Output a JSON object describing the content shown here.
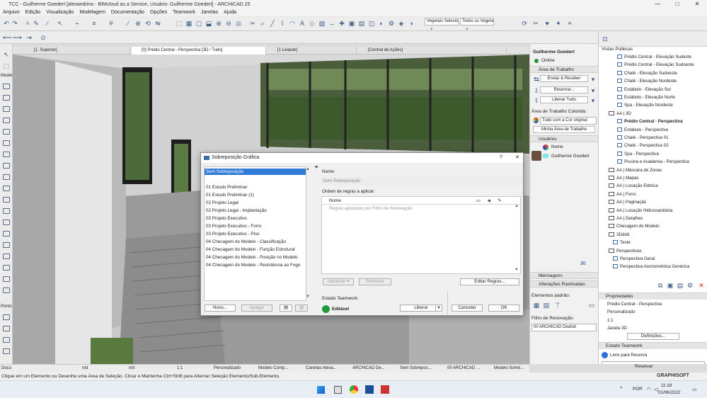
{
  "window": {
    "title": "TCC - Guilherme Goedert [alexandrino - BIMcloud as a Service, Usuário: Guilherme Goedert] - ARCHICAD 25",
    "minimize": "—",
    "maximize": "□",
    "close": "✕"
  },
  "menu": [
    "Arquivo",
    "Edição",
    "Visualização",
    "Modelagem",
    "Documentação",
    "Opções",
    "Teamwork",
    "Janelas",
    "Ajuda"
  ],
  "toolbar": {
    "layer_combo1": "Vegetais Seleciona",
    "layer_combo2": "Todos os Vegetais"
  },
  "tabs": [
    {
      "label": "[1. Superior]"
    },
    {
      "label": "[0] Prédio Central - Perspectiva [3D / Tudo]"
    },
    {
      "label": "[1 Leiaute]"
    },
    {
      "label": "[Central de Ações]"
    }
  ],
  "left_toolbox": {
    "section_model": "Model",
    "section_docu": "Docu",
    "section_ponto": "Ponto"
  },
  "teamwork": {
    "user": "Guilherme Goedert",
    "status": "Online",
    "workspace_header": "Área de Trabalho",
    "send_receive": "Enviar & Receber",
    "reserve": "Reservar...",
    "release_all": "Liberar Tudo",
    "colored_workspace_label": "Área de Trabalho Colorida:",
    "colored_workspace_value": "Tudo com a Cor original",
    "my_workspace": "Minha Área de Trabalho",
    "users_header": "Usuários",
    "name_col": "Nome",
    "user_row": "Guilherme Goedert",
    "messages": "Mensagens",
    "tracked_changes": "Alterações Rastreadas",
    "default_elements": "Elementos padrão:",
    "renovation_filter_label": "Filtro de Renovação:",
    "renovation_filter_value": "00 ARCHICAD Deafult"
  },
  "navigator": {
    "header": "Vistas Públicas",
    "items": [
      {
        "label": "Prédio Central - Elevação Sudeste",
        "type": "view"
      },
      {
        "label": "Prédio Central - Elevação Sudoeste",
        "type": "view"
      },
      {
        "label": "Chalé - Elevação Sudoeste",
        "type": "view"
      },
      {
        "label": "Chalé - Elevação Nordeste",
        "type": "view"
      },
      {
        "label": "Estábulo - Elevação Sul",
        "type": "view"
      },
      {
        "label": "Estábulo - Elevação Norte",
        "type": "view"
      },
      {
        "label": "Spa - Elevação Nordeste",
        "type": "view"
      },
      {
        "label": "AA | 3D",
        "type": "folder"
      },
      {
        "label": "Prédio Central - Perspectiva",
        "type": "view",
        "bold": true
      },
      {
        "label": "Estábulo - Perspectiva",
        "type": "view"
      },
      {
        "label": "Chalé - Perspectiva 01",
        "type": "view"
      },
      {
        "label": "Chalé - Perspectiva 02",
        "type": "view"
      },
      {
        "label": "Spa - Perspectiva",
        "type": "view"
      },
      {
        "label": "Piscina e Academia - Perspectiva",
        "type": "view"
      },
      {
        "label": "AA | Máscara de Zonas",
        "type": "folder"
      },
      {
        "label": "AA | Mapas",
        "type": "folder"
      },
      {
        "label": "AA | Locação Elétrica",
        "type": "folder"
      },
      {
        "label": "AA | Forro",
        "type": "folder"
      },
      {
        "label": "AA | Paginação",
        "type": "folder"
      },
      {
        "label": "AA | Locação Hidrossanitária",
        "type": "folder"
      },
      {
        "label": "AA | Detalhes",
        "type": "folder"
      },
      {
        "label": "Checagem do Modelo",
        "type": "folder"
      },
      {
        "label": "3Dddd",
        "type": "folder"
      },
      {
        "label": "Teste",
        "type": "view"
      },
      {
        "label": "Perspectivas",
        "type": "folder"
      },
      {
        "label": "Perspectiva Geral",
        "type": "view"
      },
      {
        "label": "Perspectiva Axonométrica Genérica",
        "type": "view"
      }
    ],
    "properties_header": "Propriedades",
    "prop_name": "Prédio Central - Perspectiva",
    "prop_custom": "Personalizado",
    "prop_scale": "1:1",
    "prop_window": "Janela 3D",
    "definitions": "Definições...",
    "teamwork_state_header": "Estado Teamwork",
    "free_reserve": "Livre para Reserva",
    "reserve_btn": "Reservar"
  },
  "dialog": {
    "title": "Sobreposição Gráfica",
    "help": "?",
    "close": "✕",
    "list": [
      "Sem Sobreposição",
      "01 Estudo Preliminar",
      "01 Estudo Preliminar (1)",
      "02 Projeto Legal",
      "02 Projeto Legal - Implantação",
      "03 Projeto Executivo",
      "03 Projeto Executivo - Forro",
      "03 Projeto Executivo - Piso",
      "04 Checagem do Modelo - Classificação",
      "04 Checagem do Modelo - Função Estrutural",
      "04 Checagem do Modelo - Posição no Modelo",
      "04 Checagem do Modelo - Resistência ao Fogo"
    ],
    "new_btn": "Novo...",
    "delete_btn": "Apagar",
    "name_label": "Nome:",
    "name_value": "Sem Sobreposição",
    "rules_label": "Ordem de regras a aplicar:",
    "rules_col_name": "Nome",
    "rules_placeholder": "Regras aplicadas por Filtro de Renovação",
    "add_btn": "Adicionar",
    "remove_btn": "Remover",
    "edit_rules_btn": "Editar Regras...",
    "teamwork_label": "Estado Teamwork:",
    "teamwork_state": "Editável",
    "release_btn": "Liberar",
    "cancel_btn": "Cancelar",
    "ok_btn": "OK"
  },
  "statusbar": {
    "nd1": "n/d",
    "nd2": "n/d",
    "scale": "1:1",
    "custom": "Personalizado",
    "model": "Modelo Comp...",
    "pens": "Canetas Alexa...",
    "archicad": "ARCHICAD De...",
    "no_override": "Sem Sobrepos...",
    "archicad2": "00 ARCHICAD ...",
    "shadow": "Modelo Somb..."
  },
  "hint": "Clique em um Elemento ou Desenhe uma Área de Seleção. Clicar e Mantenha Ctrl+Shift para Alternar Seleção Elemento/Sub-Elemento.",
  "taskbar": {
    "time": "11:18",
    "date": "01/06/2022",
    "lang": "POR",
    "graphisoft": "GRAPHISOFT"
  }
}
